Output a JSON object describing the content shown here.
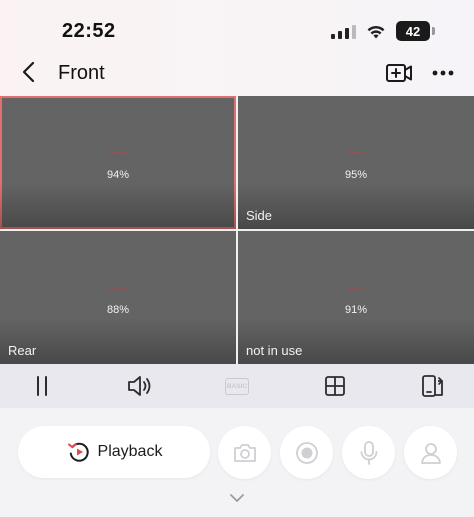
{
  "status_bar": {
    "time": "22:52",
    "battery": "42"
  },
  "nav": {
    "title": "Front"
  },
  "cameras": [
    {
      "percent": "94%",
      "label": "",
      "active": true
    },
    {
      "percent": "95%",
      "label": "Side",
      "active": false
    },
    {
      "percent": "88%",
      "label": "Rear",
      "active": false
    },
    {
      "percent": "91%",
      "label": "not in use",
      "active": false
    }
  ],
  "toolbar": {
    "quality_badge": "BASIC",
    "icons": [
      "pause-icon",
      "speaker-icon",
      "basic-quality-icon",
      "grid-layout-icon",
      "switch-screen-icon"
    ]
  },
  "bottom": {
    "playback_label": "Playback",
    "icons": [
      "playback-icon",
      "camera-icon",
      "record-icon",
      "microphone-icon",
      "contact-icon",
      "chevron-down-icon"
    ]
  },
  "colors": {
    "accent": "#e14b4b",
    "feed_bg": "#646464",
    "active_border": "#e27070"
  }
}
